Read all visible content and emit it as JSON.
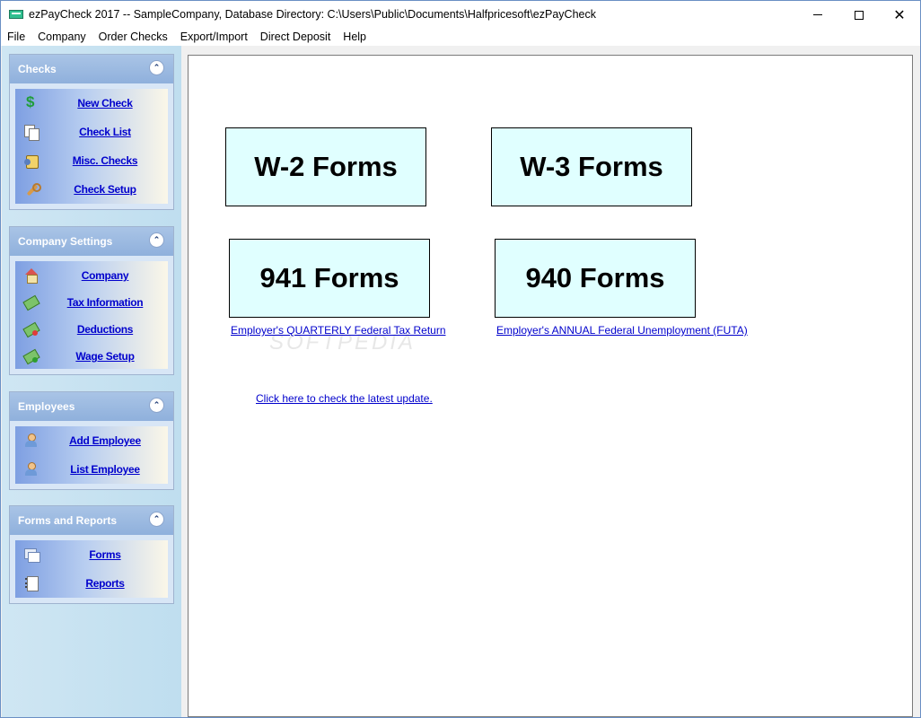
{
  "window": {
    "title": "ezPayCheck 2017 -- SampleCompany, Database Directory: C:\\Users\\Public\\Documents\\Halfpricesoft\\ezPayCheck",
    "minimize_icon": "minimize-icon",
    "maximize_icon": "maximize-icon",
    "close_glyph": "✕"
  },
  "menu": [
    "File",
    "Company",
    "Order Checks",
    "Export/Import",
    "Direct Deposit",
    "Help"
  ],
  "sidebar": {
    "collapse_glyph": "⌃",
    "groups": [
      {
        "title": "Checks",
        "items": [
          {
            "label": "New Check",
            "icon": "dollar-icon",
            "glyph": "$"
          },
          {
            "label": "Check List",
            "icon": "pages-icon"
          },
          {
            "label": "Misc. Checks",
            "icon": "misc-checks-icon"
          },
          {
            "label": "Check Setup",
            "icon": "wrench-icon"
          }
        ]
      },
      {
        "title": "Company Settings",
        "items": [
          {
            "label": "Company",
            "icon": "house-icon"
          },
          {
            "label": "Tax Information",
            "icon": "money-icon"
          },
          {
            "label": "Deductions",
            "icon": "money-minus-icon"
          },
          {
            "label": "Wage Setup",
            "icon": "money-plus-icon"
          }
        ]
      },
      {
        "title": "Employees",
        "items": [
          {
            "label": "Add Employee",
            "icon": "add-person-icon"
          },
          {
            "label": "List Employee",
            "icon": "people-icon"
          }
        ]
      },
      {
        "title": "Forms and Reports",
        "items": [
          {
            "label": "Forms",
            "icon": "forms-icon"
          },
          {
            "label": "Reports",
            "icon": "notebook-icon"
          }
        ]
      }
    ]
  },
  "main": {
    "w2_label": "W-2 Forms",
    "w3_label": "W-3 Forms",
    "f941_label": "941 Forms",
    "f940_label": "940 Forms",
    "f941_desc": "Employer's QUARTERLY Federal Tax Return",
    "f940_desc": "Employer's ANNUAL Federal Unemployment (FUTA)",
    "update_link": "Click here to check the latest update.",
    "watermark": "SOFTPEDIA"
  },
  "colors": {
    "form_box_bg": "#e0ffff",
    "link": "#0000cc",
    "group_header": "#8fb0dc"
  }
}
